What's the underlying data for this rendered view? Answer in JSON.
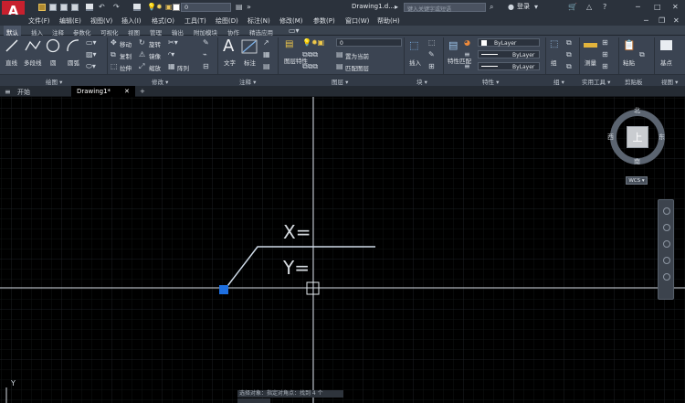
{
  "app": {
    "logo": "A",
    "document_title": "Drawing1.d...",
    "search_placeholder": "键入关键字或短语",
    "login": "登录"
  },
  "quick_access": {
    "layer_value": "0"
  },
  "menu": [
    "文件(F)",
    "编辑(E)",
    "视图(V)",
    "插入(I)",
    "格式(O)",
    "工具(T)",
    "绘图(D)",
    "标注(N)",
    "修改(M)",
    "参数(P)",
    "窗口(W)",
    "帮助(H)"
  ],
  "ribbon_tabs": [
    "默认",
    "插入",
    "注释",
    "参数化",
    "可视化",
    "视图",
    "管理",
    "输出",
    "附加模块",
    "协作",
    "精选应用"
  ],
  "panels": {
    "draw": {
      "title": "绘图 ▾",
      "tools": [
        "直线",
        "多段线",
        "圆",
        "圆弧"
      ]
    },
    "modify": {
      "title": "修改 ▾",
      "tools": [
        "移动",
        "旋转",
        "复制",
        "镜像",
        "拉伸",
        "缩放",
        "阵列"
      ]
    },
    "annotation": {
      "title": "注释 ▾",
      "tools": [
        "文字",
        "标注"
      ]
    },
    "layers": {
      "title": "图层 ▾",
      "tools": [
        "图层特性",
        "置为当前",
        "匹配图层"
      ],
      "layer_value": "0"
    },
    "block": {
      "title": "块 ▾",
      "tools": [
        "插入"
      ]
    },
    "properties": {
      "title": "特性 ▾",
      "tools": [
        "特性匹配"
      ],
      "color": "ByLayer",
      "linetype": "ByLayer",
      "lineweight": "ByLayer"
    },
    "groups": {
      "title": "组 ▾",
      "tools": [
        "组"
      ]
    },
    "utilities": {
      "title": "实用工具 ▾",
      "tools": [
        "测量"
      ]
    },
    "clipboard": {
      "title": "剪贴板",
      "tools": [
        "粘贴"
      ]
    },
    "view": {
      "title": "视图 ▾",
      "tools": [
        "基点"
      ]
    }
  },
  "file_tabs": [
    "开始",
    "Drawing1*",
    "+"
  ],
  "viewcube": {
    "north": "北",
    "south": "南",
    "east": "东",
    "west": "西",
    "face": "上",
    "wcs": "WCS ▾"
  },
  "canvas": {
    "x_label": "X=",
    "y_label": "Y=",
    "axis_y": "Y"
  },
  "command_line": {
    "prompt": "选择对象：指定对角点：找到 4 个"
  },
  "colors": {
    "background": "#000000",
    "ribbon": "#3b4452",
    "accent_red": "#c8202e",
    "grip_blue": "#1e6fe0",
    "line": "#d8e2ec"
  }
}
